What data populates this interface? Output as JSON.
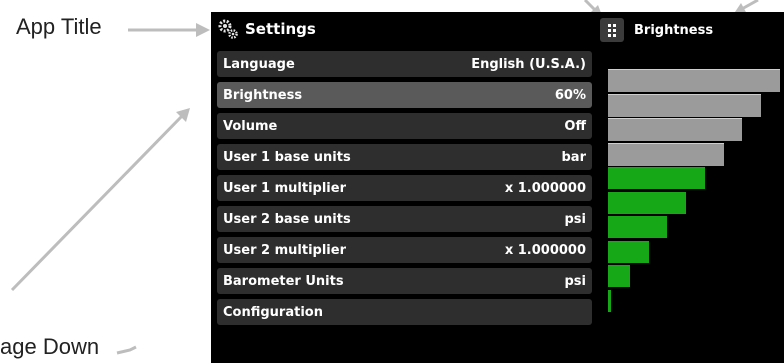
{
  "callouts": {
    "app_title": "App Title",
    "page_down": "age Down"
  },
  "header": {
    "title": "Settings",
    "title_icon": "gears-icon"
  },
  "brightness_panel": {
    "title": "Brightness",
    "menu_icon": "grid-dots-icon",
    "levels": 10,
    "filled_levels": 6,
    "level_fraction": 0.6,
    "colors": {
      "filled": "#16a816",
      "empty": "#9b9b9b"
    }
  },
  "menu": [
    {
      "label": "Language",
      "value": "English (U.S.A.)",
      "selected": false
    },
    {
      "label": "Brightness",
      "value": "60%",
      "selected": true
    },
    {
      "label": "Volume",
      "value": "Off",
      "selected": false
    },
    {
      "label": "User 1 base units",
      "value": "bar",
      "selected": false
    },
    {
      "label": "User 1 multiplier",
      "value": "x 1.000000",
      "selected": false
    },
    {
      "label": "User 2 base units",
      "value": "psi",
      "selected": false
    },
    {
      "label": "User 2 multiplier",
      "value": "x 1.000000",
      "selected": false
    },
    {
      "label": "Barometer Units",
      "value": "psi",
      "selected": false
    },
    {
      "label": "Configuration",
      "value": "",
      "selected": false
    }
  ]
}
